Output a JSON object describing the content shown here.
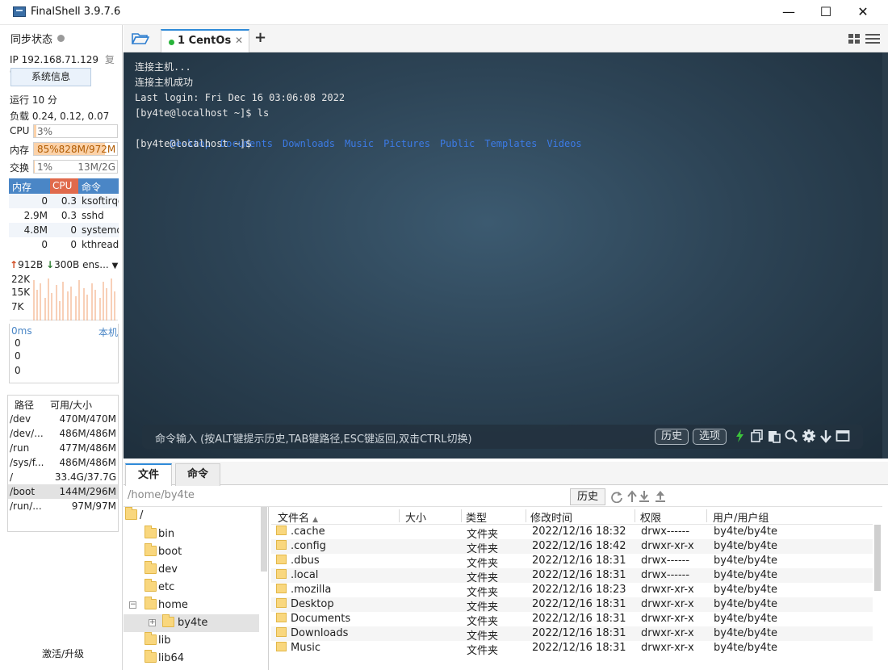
{
  "window": {
    "title": "FinalShell 3.9.7.6",
    "minimize": "—",
    "maximize": "☐",
    "close": "✕"
  },
  "sidebar": {
    "sync_label": "同步状态",
    "ip_label": "IP 192.168.71.129",
    "copy_label": "复制",
    "sysinfo_button": "系统信息",
    "uptime": "运行 10 分",
    "load": "负载 0.24, 0.12, 0.07",
    "cpu": {
      "label": "CPU",
      "value": "3%",
      "fraction": 0.03
    },
    "mem": {
      "label": "内存",
      "value": "85%828M/972M",
      "fraction": 0.85
    },
    "swap": {
      "label": "交换",
      "percent": "1%",
      "value": "13M/2G",
      "fraction": 0.01
    },
    "process_headers": {
      "mem": "内存",
      "cpu": "CPU",
      "cmd": "命令"
    },
    "processes": [
      {
        "mem": "0",
        "cpu": "0.3",
        "cmd": "ksoftirqd"
      },
      {
        "mem": "2.9M",
        "cpu": "0.3",
        "cmd": "sshd"
      },
      {
        "mem": "4.8M",
        "cpu": "0",
        "cmd": "systemd"
      },
      {
        "mem": "0",
        "cpu": "0",
        "cmd": "kthreadd"
      }
    ],
    "net": {
      "up": "912B",
      "down": "300B",
      "iface": "ens..."
    },
    "net_ticks": [
      "22K",
      "15K",
      "7K"
    ],
    "latency": {
      "ms": "0ms",
      "host": "本机",
      "values": [
        "0",
        "0",
        "0"
      ]
    },
    "disk_headers": {
      "path": "路径",
      "size": "可用/大小"
    },
    "disks": [
      {
        "path": "/dev",
        "size": "470M/470M"
      },
      {
        "path": "/dev/...",
        "size": "486M/486M"
      },
      {
        "path": "/run",
        "size": "477M/486M"
      },
      {
        "path": "/sys/f...",
        "size": "486M/486M"
      },
      {
        "path": "/",
        "size": "33.4G/37.7G"
      },
      {
        "path": "/boot",
        "size": "144M/296M"
      },
      {
        "path": "/run/...",
        "size": "97M/97M"
      }
    ],
    "activate": "激活/升级"
  },
  "tabs": {
    "session_label": "1 CentOs",
    "close": "✕",
    "add": "+"
  },
  "terminal": {
    "lines": [
      "连接主机...",
      "连接主机成功",
      "Last login: Fri Dec 16 03:06:08 2022",
      "[by4te@localhost ~]$ ls",
      "",
      "[by4te@localhost ~]$"
    ],
    "ls_items": [
      "Desktop",
      "Documents",
      "Downloads",
      "Music",
      "Pictures",
      "Public",
      "Templates",
      "Videos"
    ],
    "command_placeholder": "命令输入 (按ALT键提示历史,TAB键路径,ESC键返回,双击CTRL切换)",
    "history_button": "历史",
    "options_button": "选项"
  },
  "file_pane": {
    "tabs": [
      "文件",
      "命令"
    ],
    "path": "/home/by4te",
    "history_button": "历史",
    "tree": [
      {
        "label": "/"
      },
      {
        "label": "bin"
      },
      {
        "label": "boot"
      },
      {
        "label": "dev"
      },
      {
        "label": "etc"
      },
      {
        "label": "home"
      },
      {
        "label": "by4te"
      },
      {
        "label": "lib"
      },
      {
        "label": "lib64"
      }
    ],
    "columns": {
      "name": "文件名",
      "size": "大小",
      "type": "类型",
      "modified": "修改时间",
      "perm": "权限",
      "owner": "用户/用户组"
    },
    "files": [
      {
        "name": ".cache",
        "type": "文件夹",
        "modified": "2022/12/16 18:32",
        "perm": "drwx------",
        "owner": "by4te/by4te"
      },
      {
        "name": ".config",
        "type": "文件夹",
        "modified": "2022/12/16 18:42",
        "perm": "drwxr-xr-x",
        "owner": "by4te/by4te"
      },
      {
        "name": ".dbus",
        "type": "文件夹",
        "modified": "2022/12/16 18:31",
        "perm": "drwx------",
        "owner": "by4te/by4te"
      },
      {
        "name": ".local",
        "type": "文件夹",
        "modified": "2022/12/16 18:31",
        "perm": "drwx------",
        "owner": "by4te/by4te"
      },
      {
        "name": ".mozilla",
        "type": "文件夹",
        "modified": "2022/12/16 18:23",
        "perm": "drwxr-xr-x",
        "owner": "by4te/by4te"
      },
      {
        "name": "Desktop",
        "type": "文件夹",
        "modified": "2022/12/16 18:31",
        "perm": "drwxr-xr-x",
        "owner": "by4te/by4te"
      },
      {
        "name": "Documents",
        "type": "文件夹",
        "modified": "2022/12/16 18:31",
        "perm": "drwxr-xr-x",
        "owner": "by4te/by4te"
      },
      {
        "name": "Downloads",
        "type": "文件夹",
        "modified": "2022/12/16 18:31",
        "perm": "drwxr-xr-x",
        "owner": "by4te/by4te"
      },
      {
        "name": "Music",
        "type": "文件夹",
        "modified": "2022/12/16 18:31",
        "perm": "drwxr-xr-x",
        "owner": "by4te/by4te"
      }
    ]
  },
  "colors": {
    "accent": "#2f8ad8",
    "terminal_bg": "#2d4456",
    "ls_dir": "#3c7be6",
    "cpu_header": "#e06a4c",
    "mem_header": "#4a86c6"
  },
  "icons": [
    "app-icon",
    "folder-open-icon",
    "layout-grid-icon",
    "menu-icon",
    "lightning-icon",
    "copy-icon",
    "paste-icon",
    "search-icon",
    "gear-icon",
    "download-arrow-icon",
    "window-icon",
    "refresh-icon",
    "upload-icon",
    "download-icon",
    "folder-icon"
  ]
}
